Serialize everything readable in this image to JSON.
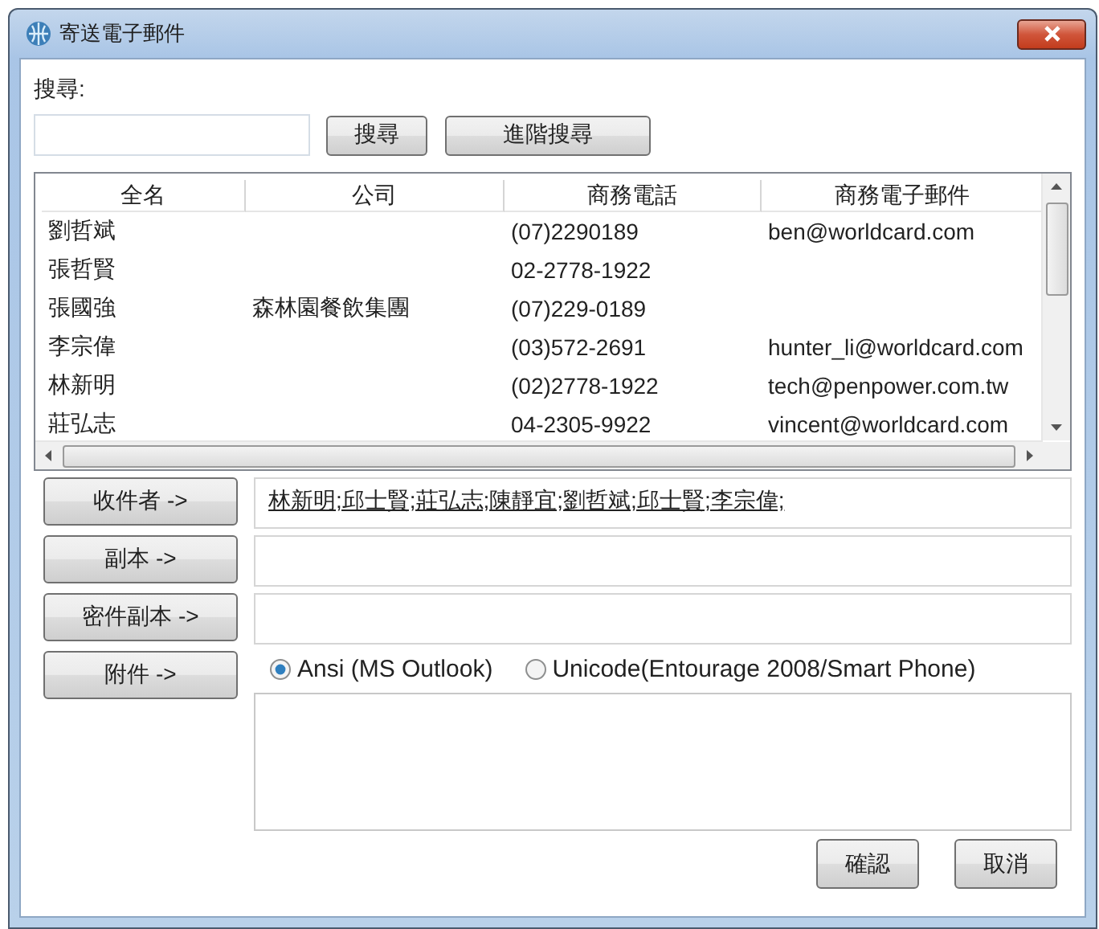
{
  "window": {
    "title": "寄送電子郵件"
  },
  "search": {
    "label": "搜尋:",
    "buttons": [
      "搜尋",
      "進階搜尋"
    ]
  },
  "table": {
    "columns": [
      "全名",
      "公司",
      "商務電話",
      "商務電子郵件"
    ],
    "rows": [
      [
        "劉哲斌",
        "",
        "(07)2290189",
        "ben@worldcard.com"
      ],
      [
        "張哲賢",
        "",
        "02-2778-1922",
        ""
      ],
      [
        "張國強",
        "森林園餐飲集團",
        "(07)229-0189",
        ""
      ],
      [
        "李宗偉",
        "",
        "(03)572-2691",
        "hunter_li@worldcard.com"
      ],
      [
        "林新明",
        "",
        "(02)2778-1922",
        "tech@penpower.com.tw"
      ],
      [
        "莊弘志",
        "",
        "04-2305-9922",
        "vincent@worldcard.com"
      ]
    ]
  },
  "recipients": [
    {
      "button": "收件者 ->",
      "value": "林新明;邱士賢;莊弘志;陳靜宜;劉哲斌;邱士賢;李宗偉;"
    },
    {
      "button": "副本 ->"
    },
    {
      "button": "密件副本 ->"
    }
  ],
  "attachment": {
    "button": "附件 ->",
    "encodings": [
      {
        "label": "Ansi (MS Outlook)",
        "selected": true
      },
      {
        "label": "Unicode(Entourage 2008/Smart Phone)",
        "selected": false
      }
    ]
  },
  "buttons": [
    "確認",
    "取消"
  ]
}
